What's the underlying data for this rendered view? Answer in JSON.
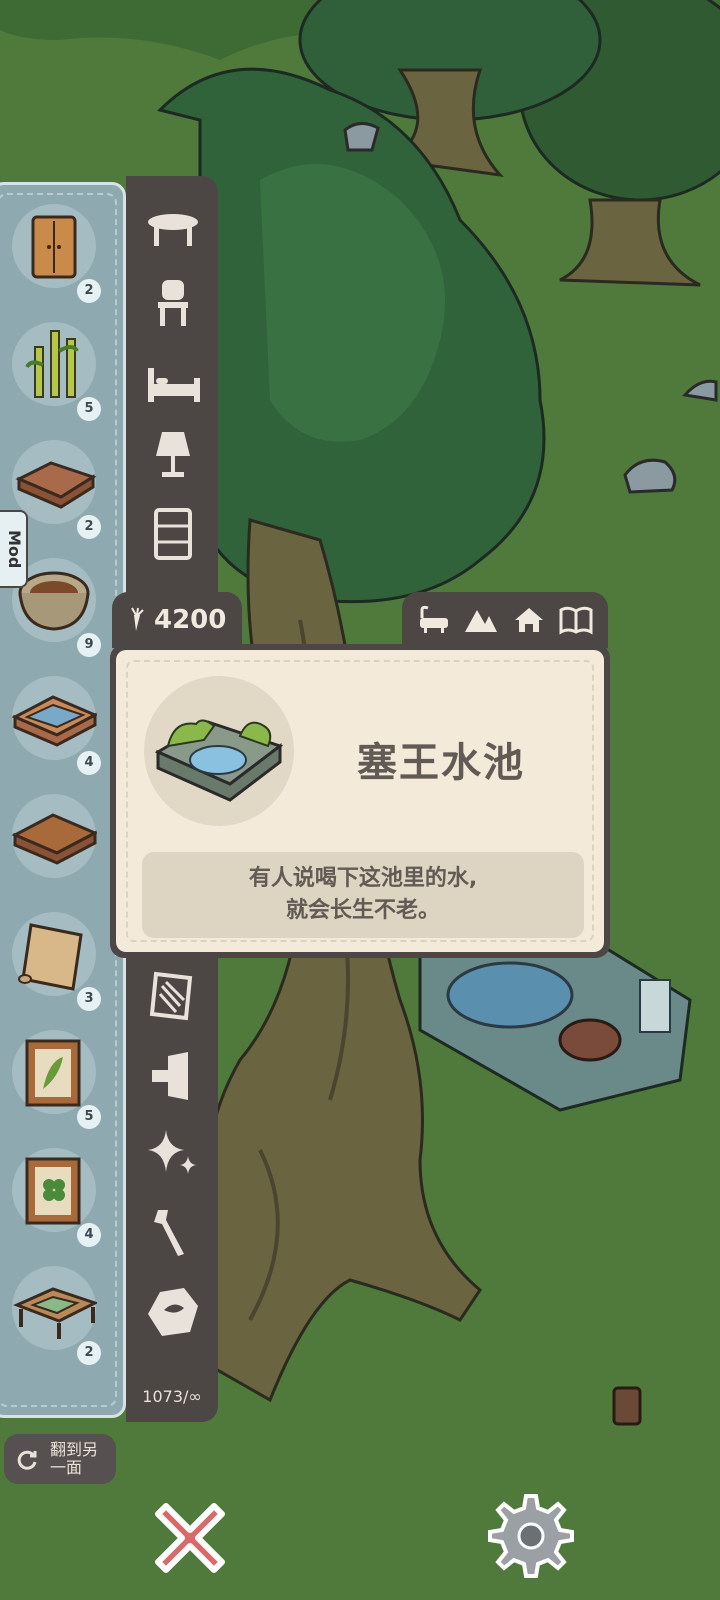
{
  "inventory": {
    "items": [
      {
        "name": "wardrobe",
        "count": "2"
      },
      {
        "name": "bamboo",
        "count": "5"
      },
      {
        "name": "wooden-tray",
        "count": "2"
      },
      {
        "name": "stone-basin",
        "count": "9"
      },
      {
        "name": "glass-table",
        "count": "4"
      },
      {
        "name": "wooden-table",
        "count": ""
      },
      {
        "name": "scroll",
        "count": "3"
      },
      {
        "name": "leaf-frame",
        "count": "5"
      },
      {
        "name": "clover-frame",
        "count": "4"
      },
      {
        "name": "low-table",
        "count": "2"
      }
    ]
  },
  "categories": {
    "icons": [
      "table-icon",
      "chair-icon",
      "bed-icon",
      "lamp-icon",
      "shelf-icon",
      "rug-icon",
      "wall-icon",
      "sparkle-icon",
      "tools-icon",
      "stone-icon"
    ],
    "footer": "1073/∞"
  },
  "mod_tab": "Mod",
  "flip": {
    "label": "翻到另一面"
  },
  "item_card": {
    "price": "4200",
    "name": "塞王水池",
    "desc_line1": "有人说喝下这池里的水,",
    "desc_line2": "就会长生不老。",
    "tag_icons": [
      "bathtub-icon",
      "mountain-icon",
      "house-icon",
      "book-icon"
    ]
  },
  "colors": {
    "panel_dark": "#4c4645",
    "card_bg": "#f3ead9",
    "grass": "#4f7a3b",
    "inventory_bg": "#8fa9b0"
  }
}
